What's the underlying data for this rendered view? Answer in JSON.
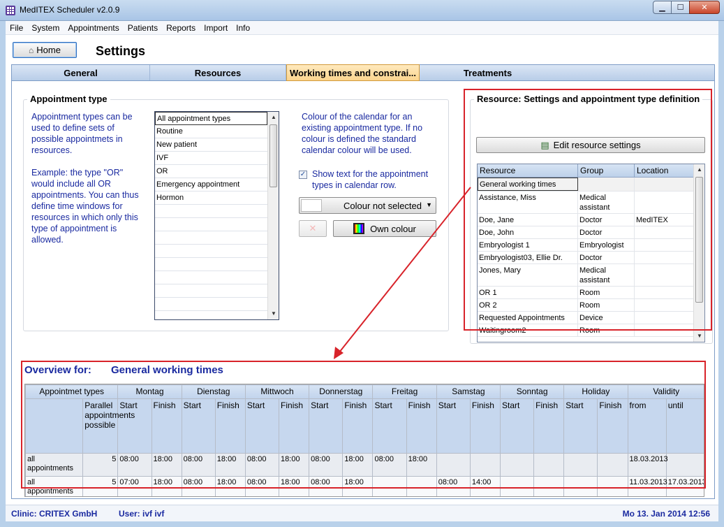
{
  "window": {
    "title": "MedITEX  Scheduler  v2.0.9",
    "buttons": {
      "minimize": "▁",
      "maximize": "☐",
      "close": "✕"
    }
  },
  "menu": [
    "File",
    "System",
    "Appointments",
    "Patients",
    "Reports",
    "Import",
    "Info"
  ],
  "header": {
    "home_label": "Home",
    "page_title": "Settings"
  },
  "tabs": [
    "General",
    "Resources",
    "Working times and constrai...",
    "Treatments"
  ],
  "active_tab": 2,
  "appointment_type": {
    "title": "Appointment type",
    "description1": "Appointment types can be used to define sets of possible appointmets in resources.",
    "description2": "Example: the type \"OR\" would include all OR appointments. You can thus define time windows for resources in which only this type of appointment is allowed.",
    "items": [
      "All appointment types",
      "Routine",
      "New patient",
      "IVF",
      "OR",
      "Emergency appointment",
      "Hormon"
    ],
    "selected": 0,
    "colour_text": "Colour of the calendar for an existing appointment type. If no colour is defined the standard calendar colour will be used.",
    "show_text_label": "Show text for the appointment types in calendar row.",
    "show_text_checked": true,
    "colour_select_label": "Colour not selected",
    "own_colour_label": "Own colour"
  },
  "resource_panel": {
    "title": "Resource: Settings and appointment type definition",
    "edit_button": "Edit resource settings",
    "columns": [
      "Resource",
      "Group",
      "Location"
    ],
    "rows": [
      {
        "resource": "General working times",
        "group": "",
        "location": ""
      },
      {
        "resource": "Assistance, Miss",
        "group": "Medical assistant",
        "location": ""
      },
      {
        "resource": "Doe, Jane",
        "group": "Doctor",
        "location": "MedITEX"
      },
      {
        "resource": "Doe, John",
        "group": "Doctor",
        "location": ""
      },
      {
        "resource": "Embryologist 1",
        "group": "Embryologist",
        "location": ""
      },
      {
        "resource": "Embryologist03, Ellie Dr.",
        "group": "Doctor",
        "location": ""
      },
      {
        "resource": "Jones, Mary",
        "group": "Medical assistant",
        "location": ""
      },
      {
        "resource": "OR 1",
        "group": "Room",
        "location": ""
      },
      {
        "resource": "OR 2",
        "group": "Room",
        "location": ""
      },
      {
        "resource": "Requested Appointments",
        "group": "Device",
        "location": ""
      },
      {
        "resource": "Waitingroom2",
        "group": "Room",
        "location": ""
      }
    ]
  },
  "overview": {
    "label": "Overview for:",
    "resource_name": "General working times",
    "group_headers": [
      "Appointmet types",
      "Montag",
      "Dienstag",
      "Mittwoch",
      "Donnerstag",
      "Freitag",
      "Samstag",
      "Sonntag",
      "Holiday",
      "Validity"
    ],
    "sub_headers": [
      "",
      "Parallel appointments possible",
      "Start",
      "Finish",
      "Start",
      "Finish",
      "Start",
      "Finish",
      "Start",
      "Finish",
      "Start",
      "Finish",
      "Start",
      "Finish",
      "Start",
      "Finish",
      "Start",
      "Finish",
      "from",
      "until"
    ],
    "rows": [
      [
        "all appointments",
        "5",
        "08:00",
        "18:00",
        "08:00",
        "18:00",
        "08:00",
        "18:00",
        "08:00",
        "18:00",
        "08:00",
        "18:00",
        "",
        "",
        "",
        "",
        "",
        "",
        "18.03.2013",
        ""
      ],
      [
        "all appointments",
        "5",
        "07:00",
        "18:00",
        "08:00",
        "18:00",
        "08:00",
        "18:00",
        "08:00",
        "18:00",
        "",
        "",
        "08:00",
        "14:00",
        "",
        "",
        "",
        "",
        "11.03.2013",
        "17.03.2013"
      ]
    ]
  },
  "status": {
    "clinic": "Clinic: CRITEX GmbH",
    "user": "User: ivf ivf",
    "datetime": "Mo 13. Jan 2014 12:56"
  },
  "colors": {
    "accent_text": "#1a2aa0",
    "annotation_red": "#d8232a",
    "active_tab": "#fbd58e"
  }
}
